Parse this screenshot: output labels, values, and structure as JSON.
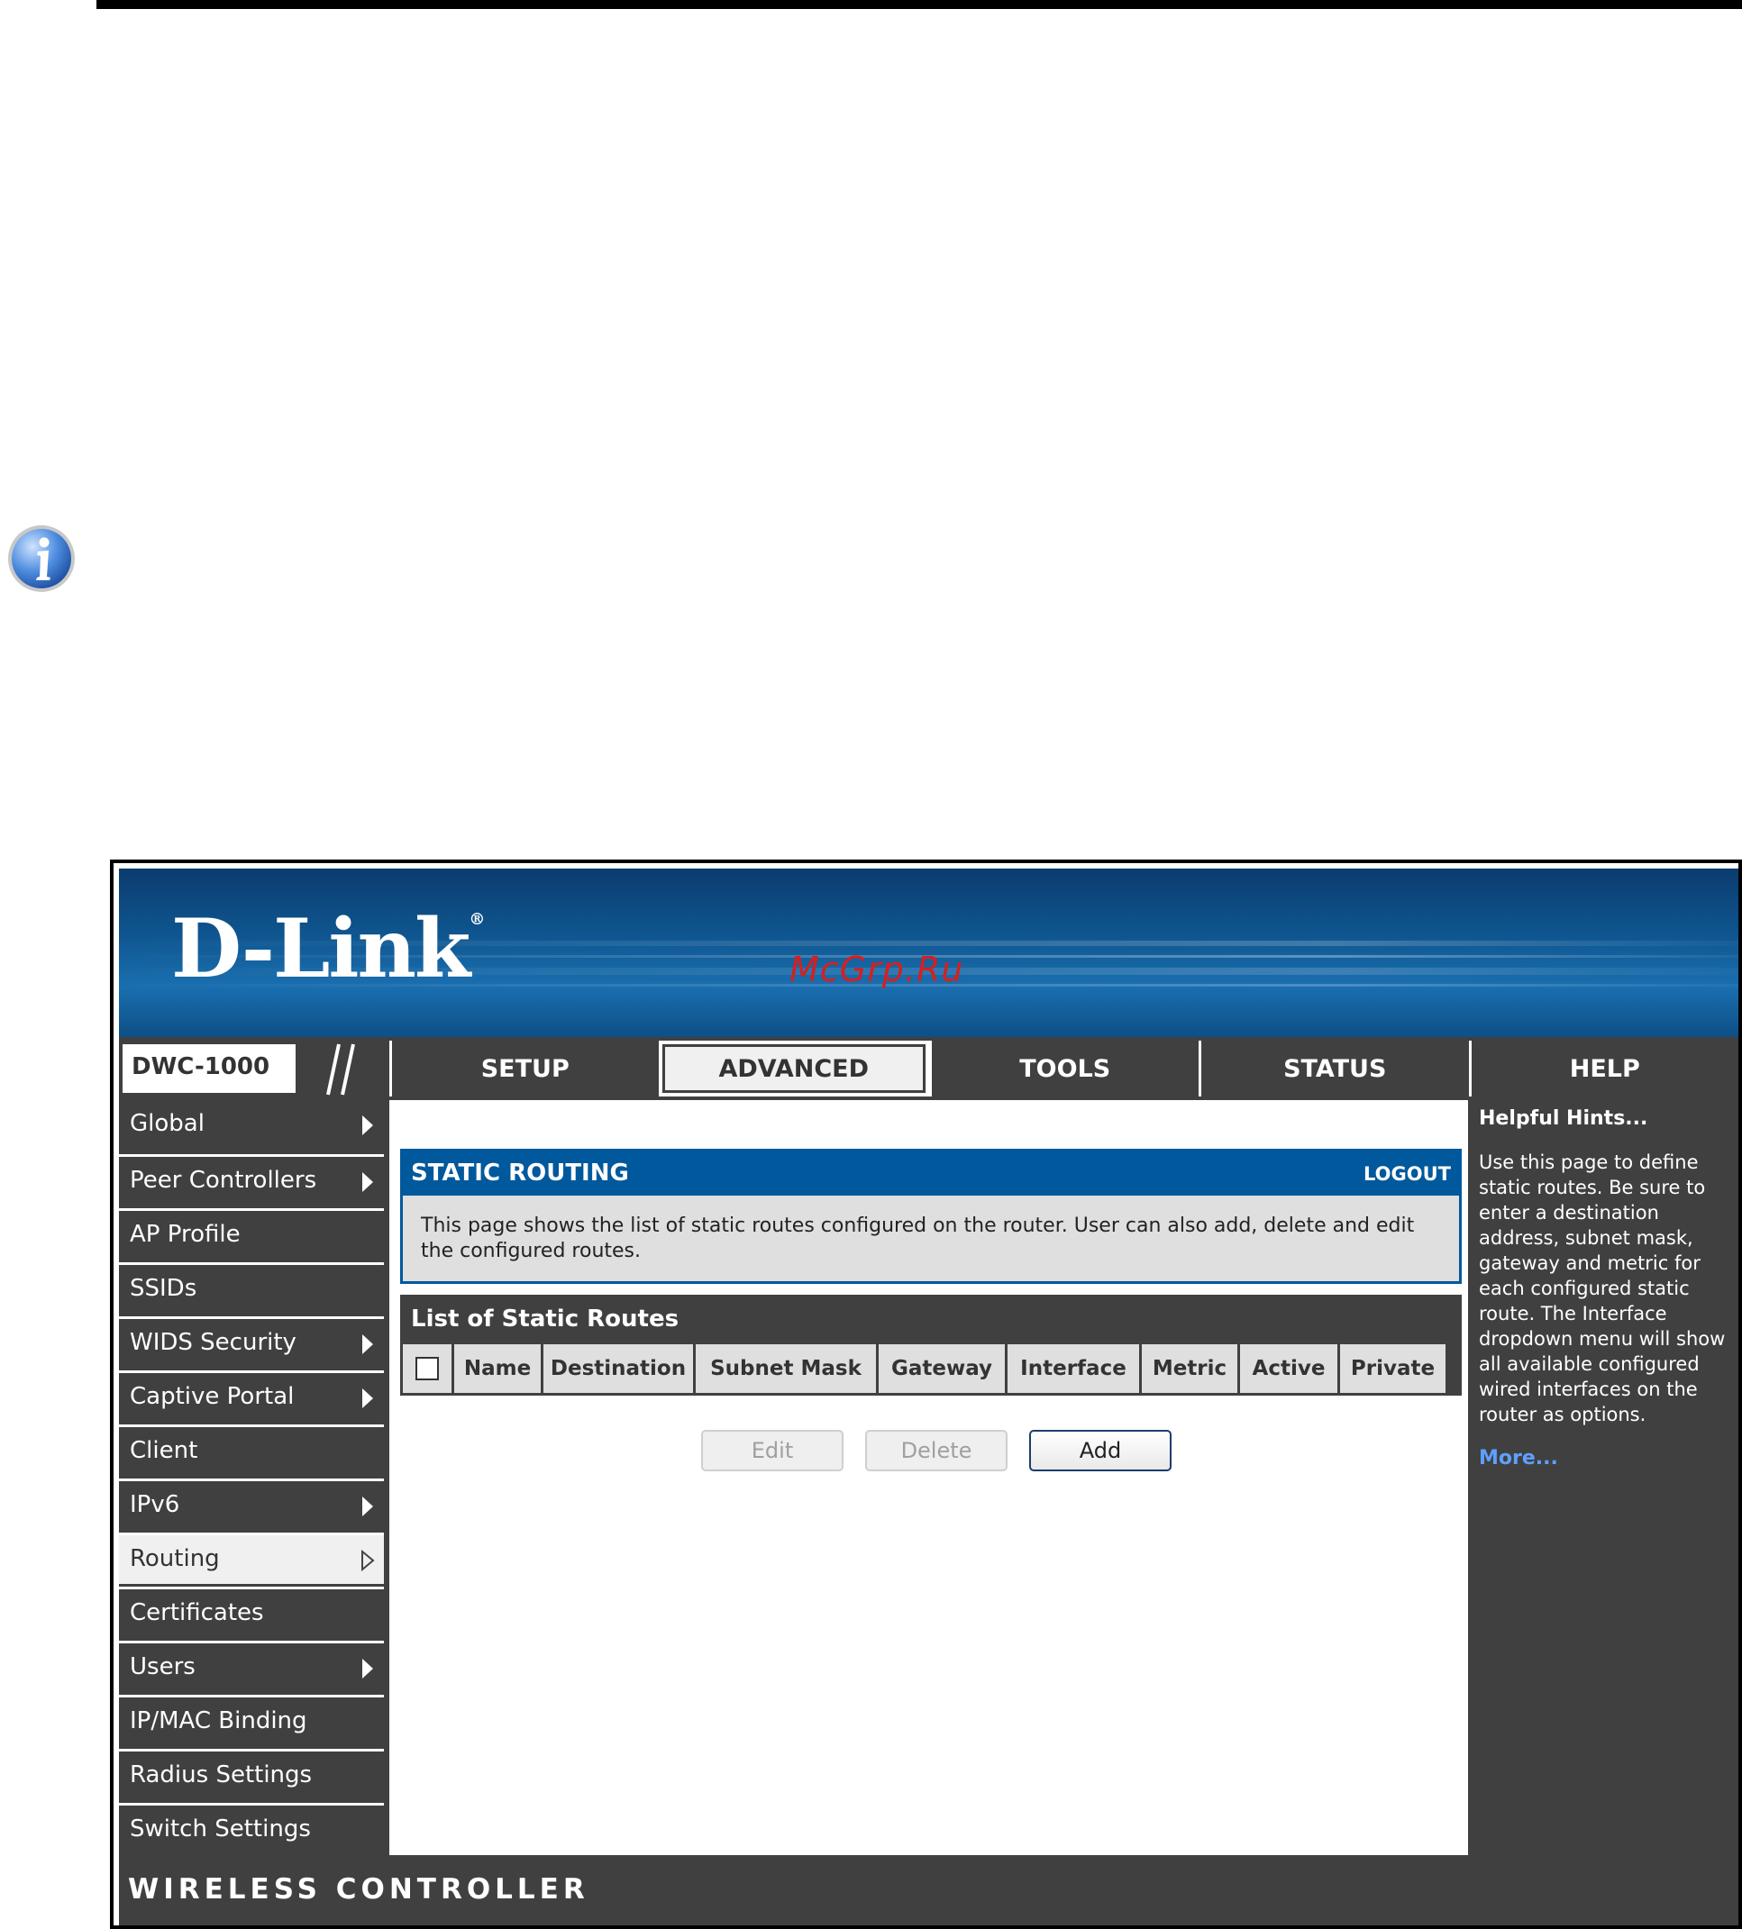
{
  "watermark": "McGrp.Ru",
  "brand": {
    "logo": "D-Link",
    "registered": "®"
  },
  "model": "DWC-1000",
  "tabs": [
    {
      "label": "SETUP",
      "active": false
    },
    {
      "label": "ADVANCED",
      "active": true
    },
    {
      "label": "TOOLS",
      "active": false
    },
    {
      "label": "STATUS",
      "active": false
    },
    {
      "label": "HELP",
      "active": false
    }
  ],
  "sidebar": {
    "items": [
      {
        "label": "Global"
      },
      {
        "label": "Peer Controllers"
      },
      {
        "label": "AP Profile"
      },
      {
        "label": "SSIDs"
      },
      {
        "label": "WIDS Security"
      },
      {
        "label": "Captive Portal"
      },
      {
        "label": "Client"
      },
      {
        "label": "IPv6"
      },
      {
        "label": "Routing"
      },
      {
        "label": "Certificates"
      },
      {
        "label": "Users"
      },
      {
        "label": "IP/MAC Binding"
      },
      {
        "label": "Radius Settings"
      },
      {
        "label": "Switch Settings"
      }
    ]
  },
  "main": {
    "title": "STATIC ROUTING",
    "logout": "LOGOUT",
    "description": "This page shows the list of static routes configured on the router. User can also add, delete and edit the configured routes.",
    "list_title": "List of Static Routes",
    "columns": [
      "Name",
      "Destination",
      "Subnet Mask",
      "Gateway",
      "Interface",
      "Metric",
      "Active",
      "Private"
    ],
    "buttons": {
      "edit": "Edit",
      "delete": "Delete",
      "add": "Add"
    }
  },
  "help": {
    "title": "Helpful Hints...",
    "text": "Use this page to define static routes. Be sure to enter a destination address, subnet mask, gateway and metric for each configured static route. The Interface dropdown menu will show all available configured wired interfaces on the router as options.",
    "more": "More..."
  },
  "footer": "WIRELESS CONTROLLER",
  "colors": {
    "panel_blue": "#00599c",
    "dark_gray": "#404040",
    "light_gray": "#dfdfdf"
  }
}
